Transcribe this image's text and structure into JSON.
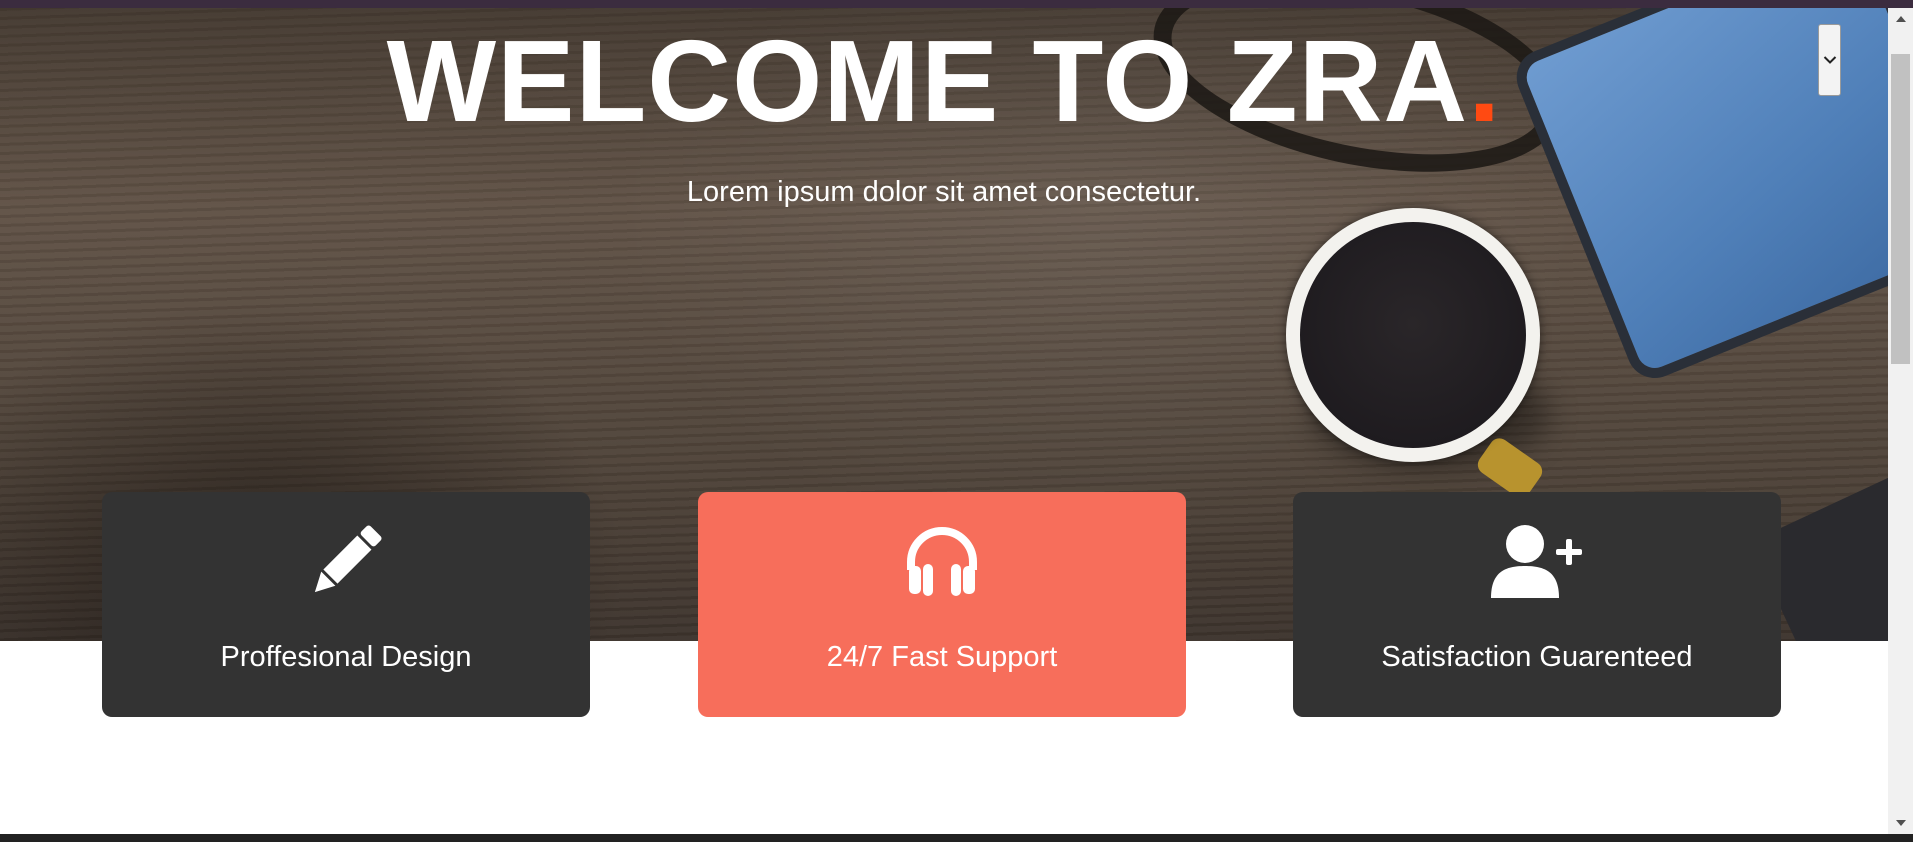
{
  "hero": {
    "title_main": "WELCOME TO ZRA",
    "title_dot": ".",
    "subtitle": "Lorem ipsum dolor sit amet consectetur."
  },
  "nav": {
    "menu_toggle_icon": "chevron-down-icon"
  },
  "features": [
    {
      "label": "Proffesional Design",
      "icon": "pencil-icon",
      "bg": "#333333"
    },
    {
      "label": "24/7 Fast Support",
      "icon": "headphones-icon",
      "bg": "#f76e5b"
    },
    {
      "label": "Satisfaction Guarenteed",
      "icon": "user-plus-icon",
      "bg": "#333333"
    }
  ],
  "colors": {
    "accent": "#ff4a12",
    "card_dark": "#333333",
    "card_accent": "#f76e5b"
  }
}
